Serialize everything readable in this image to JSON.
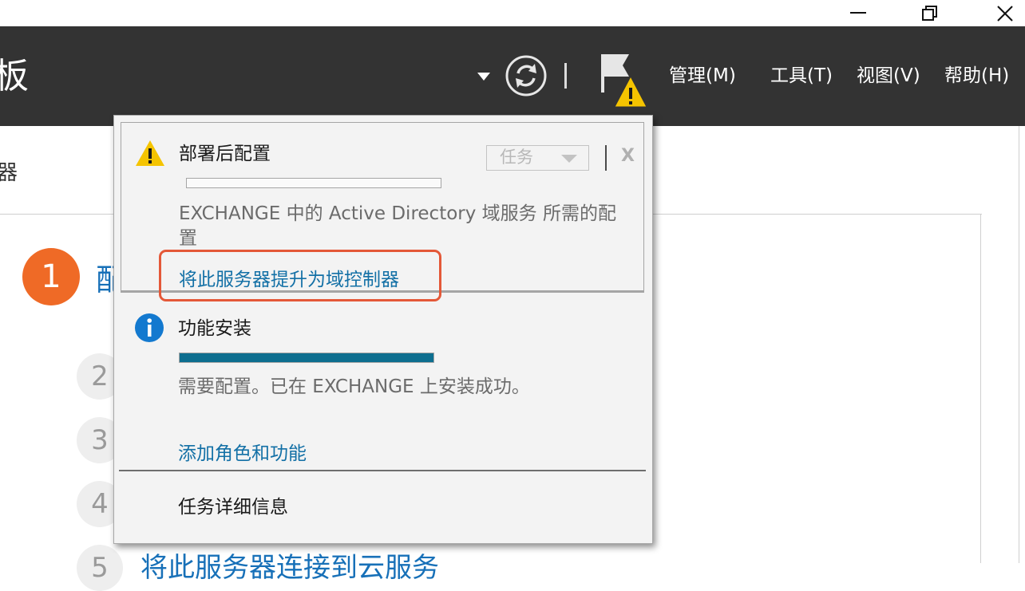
{
  "window": {
    "minimize_icon": "minimize-icon",
    "restore_icon": "restore-icon",
    "close_icon": "close-icon"
  },
  "header": {
    "title_fragment": "板",
    "menu": {
      "manage": "管理(M)",
      "tools": "工具(T)",
      "view": "视图(V)",
      "help": "帮助(H)"
    },
    "icons": [
      "dropdown-arrow-icon",
      "refresh-icon",
      "notification-flag-warning-icon"
    ]
  },
  "page": {
    "breadcrumb_fragment": "器",
    "steps": [
      {
        "number": "1",
        "label_fragment": "配"
      },
      {
        "number": "2"
      },
      {
        "number": "3"
      },
      {
        "number": "4"
      },
      {
        "number": "5",
        "label_fragment": "将此服务器连接到云服务"
      }
    ]
  },
  "notifications": {
    "post_deploy": {
      "title": "部署后配置",
      "task_dropdown": "任务",
      "close": "X",
      "progress": 0,
      "description_line1": "EXCHANGE 中的 Active Directory 域服务 所需的配",
      "description_line2": "置",
      "link": "将此服务器提升为域控制器"
    },
    "feature_install": {
      "title": "功能安装",
      "progress": 1.0,
      "description": "需要配置。已在 EXCHANGE 上安装成功。",
      "link": "添加角色和功能"
    },
    "task_details": "任务详细信息"
  },
  "colors": {
    "header_bg": "#333333",
    "accent_orange": "#ef6a26",
    "link_blue": "#1370a6",
    "progress_fill": "#0d6e8f",
    "highlight_red": "#e45838",
    "warning_yellow": "#f5c400",
    "info_blue": "#1379cf"
  }
}
